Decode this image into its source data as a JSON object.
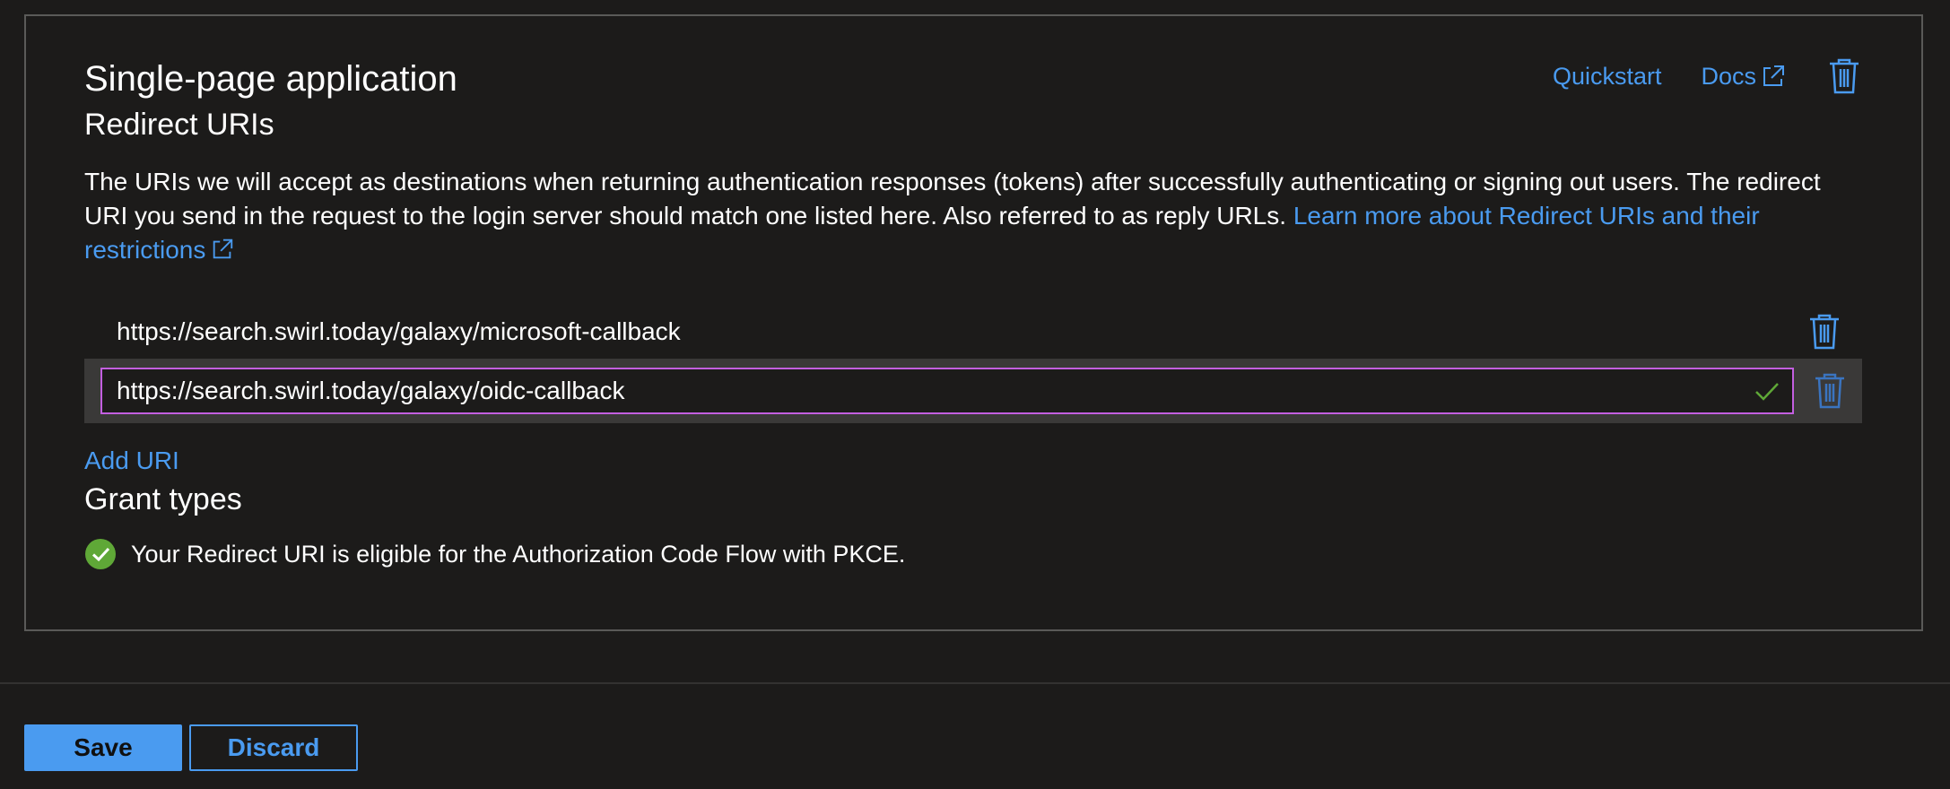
{
  "section": {
    "title": "Single-page application",
    "subtitle": "Redirect URIs",
    "description": "The URIs we will accept as destinations when returning authentication responses (tokens) after successfully authenticating or signing out users. The redirect URI you send in the request to the login server should match one listed here. Also referred to as reply URLs. ",
    "learn_more_label": "Learn more about Redirect URIs and their restrictions"
  },
  "top_links": {
    "quickstart_label": "Quickstart",
    "docs_label": "Docs"
  },
  "redirect_uris": [
    {
      "value": "https://search.swirl.today/galaxy/microsoft-callback"
    },
    {
      "value": "https://search.swirl.today/galaxy/oidc-callback"
    }
  ],
  "add_uri_label": "Add URI",
  "grant_types": {
    "title": "Grant types",
    "status_text": "Your Redirect URI is eligible for the Authorization Code Flow with PKCE."
  },
  "footer": {
    "save_label": "Save",
    "discard_label": "Discard"
  },
  "colors": {
    "accent": "#4a9bf0",
    "focus_border": "#c35fe0",
    "success": "#5fa837",
    "background": "#1c1b1a"
  },
  "icons": [
    "external-link-icon",
    "trash-icon",
    "check-icon",
    "success-check-icon"
  ]
}
